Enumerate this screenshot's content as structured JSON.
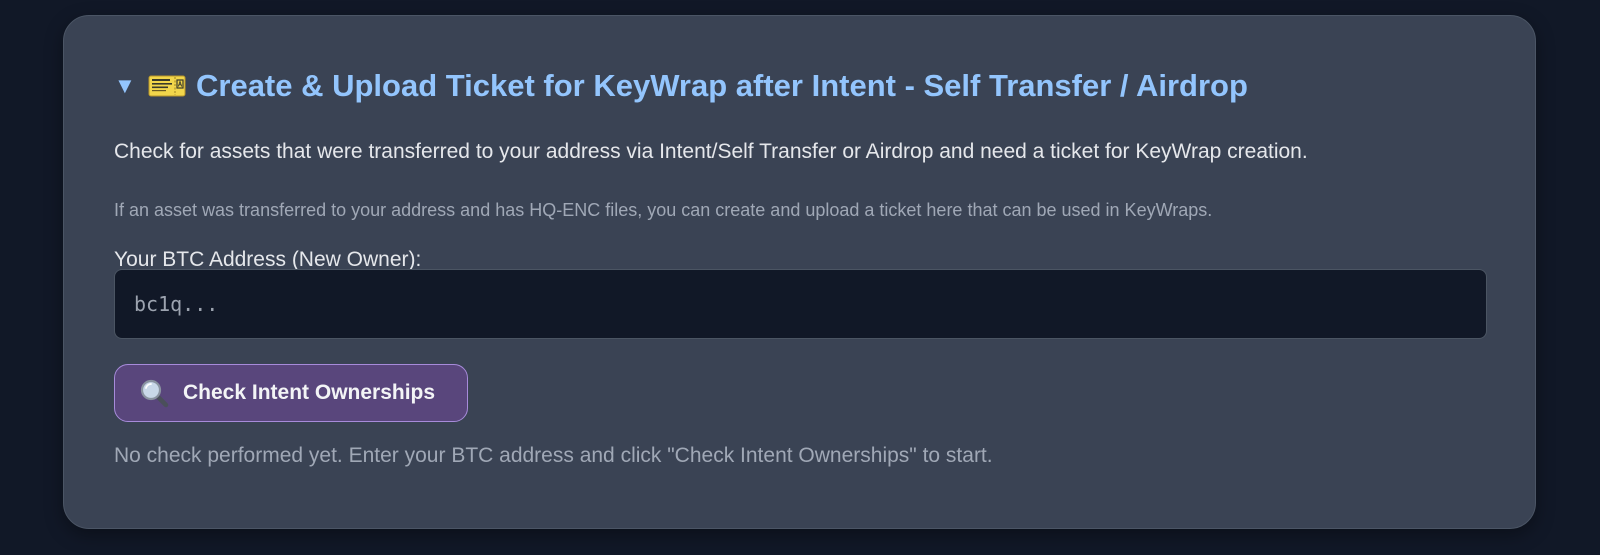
{
  "section": {
    "toggle_glyph": "▼",
    "icon": "ticket-icon",
    "title": "Create & Upload Ticket for KeyWrap after Intent - Self Transfer / Airdrop",
    "title_color": "#93c5fd"
  },
  "description": "Check for assets that were transferred to your address via Intent/Self Transfer or Airdrop and need a ticket for KeyWrap creation.",
  "hint": "If an asset was transferred to your address and has HQ-ENC files, you can create and upload a ticket here that can be used in KeyWraps.",
  "address_field": {
    "label": "Your BTC Address (New Owner):",
    "placeholder": "bc1q...",
    "value": ""
  },
  "check_button": {
    "icon": "magnifying-glass-icon",
    "label": "Check Intent Ownerships",
    "color": "#59467c",
    "border_color": "#a78bda"
  },
  "status_message": "No check performed yet. Enter your BTC address and click \"Check Intent Ownerships\" to start.",
  "colors": {
    "page_background": "#111827",
    "panel_background": "#3a4354"
  }
}
